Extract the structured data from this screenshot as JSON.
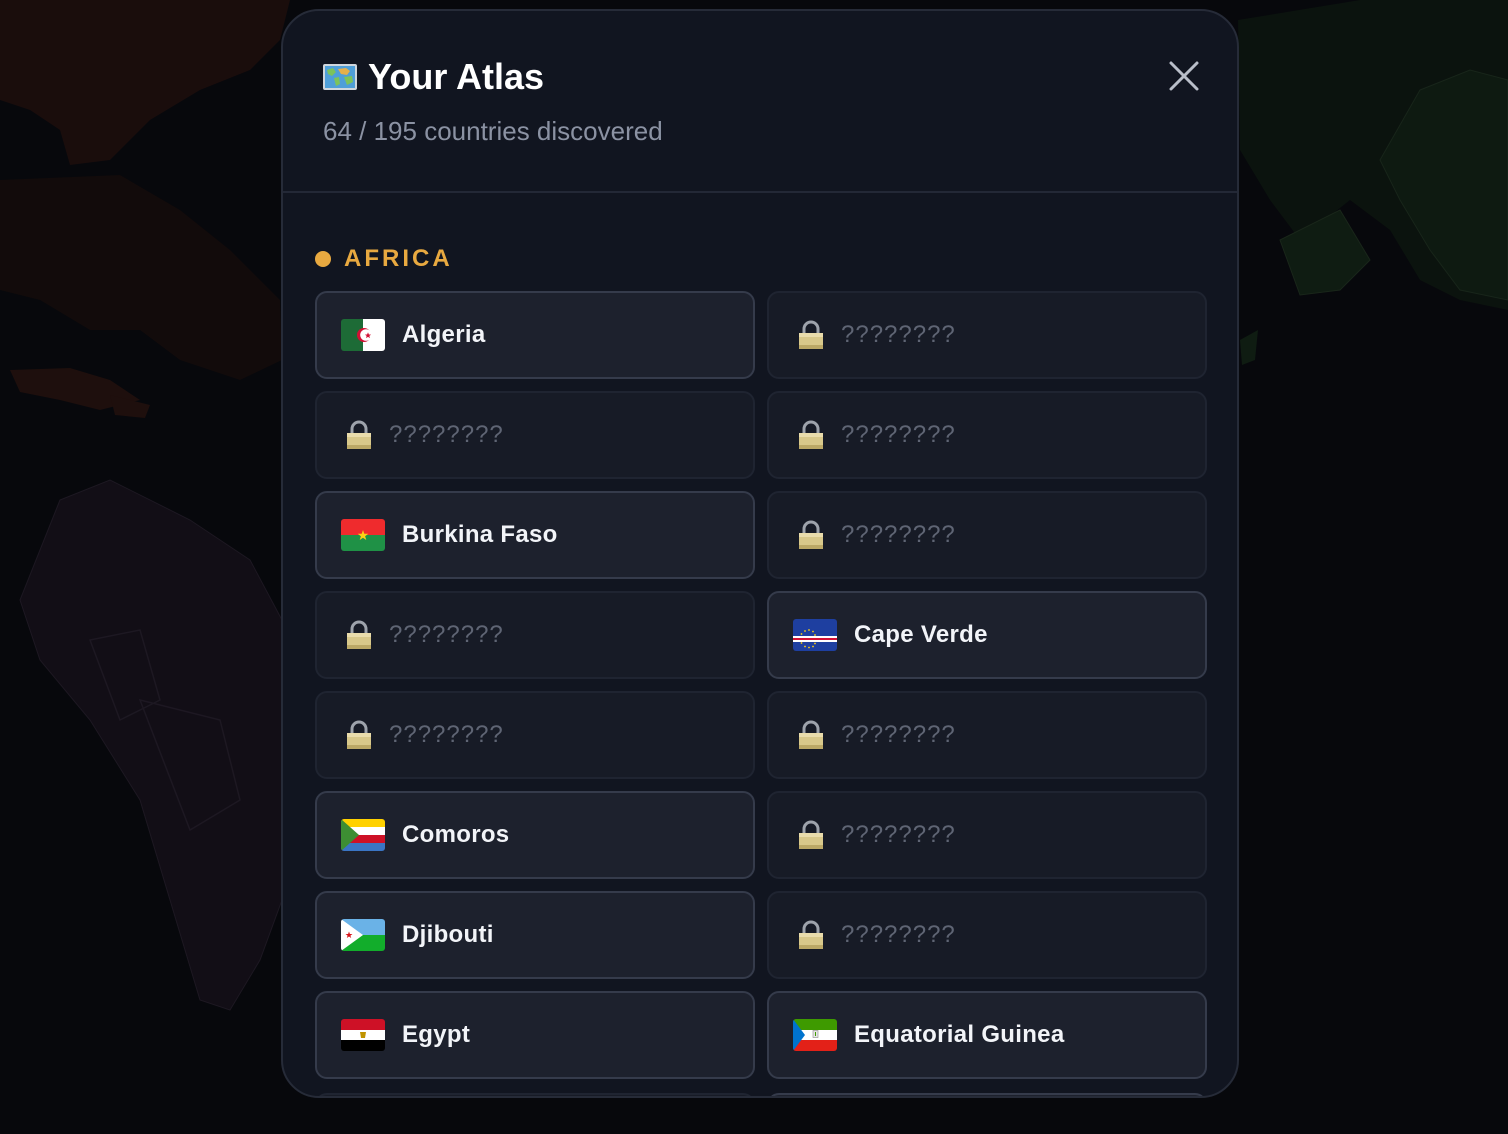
{
  "header": {
    "title": "Your Atlas",
    "discovered": 64,
    "total": 195,
    "subtitle": "64 / 195 countries discovered",
    "close_icon": "close-icon",
    "title_icon": "world-map-icon"
  },
  "section": {
    "region": "AFRICA",
    "accent_color": "#e8a940"
  },
  "locked_placeholder": "????????",
  "cards": [
    {
      "status": "found",
      "name": "Algeria",
      "flag": "algeria"
    },
    {
      "status": "locked",
      "name": "????????"
    },
    {
      "status": "locked",
      "name": "????????"
    },
    {
      "status": "locked",
      "name": "????????"
    },
    {
      "status": "found",
      "name": "Burkina Faso",
      "flag": "burkina-faso"
    },
    {
      "status": "locked",
      "name": "????????"
    },
    {
      "status": "locked",
      "name": "????????"
    },
    {
      "status": "found",
      "name": "Cape Verde",
      "flag": "cape-verde"
    },
    {
      "status": "locked",
      "name": "????????"
    },
    {
      "status": "locked",
      "name": "????????"
    },
    {
      "status": "found",
      "name": "Comoros",
      "flag": "comoros"
    },
    {
      "status": "locked",
      "name": "????????"
    },
    {
      "status": "found",
      "name": "Djibouti",
      "flag": "djibouti"
    },
    {
      "status": "locked",
      "name": "????????"
    },
    {
      "status": "found",
      "name": "Egypt",
      "flag": "egypt"
    },
    {
      "status": "found",
      "name": "Equatorial Guinea",
      "flag": "equatorial-guinea"
    }
  ],
  "colors": {
    "modal_bg": "#111520",
    "card_found_bg": "#1d212d",
    "card_locked_bg": "#171b26",
    "locked_text": "#5f6574"
  }
}
